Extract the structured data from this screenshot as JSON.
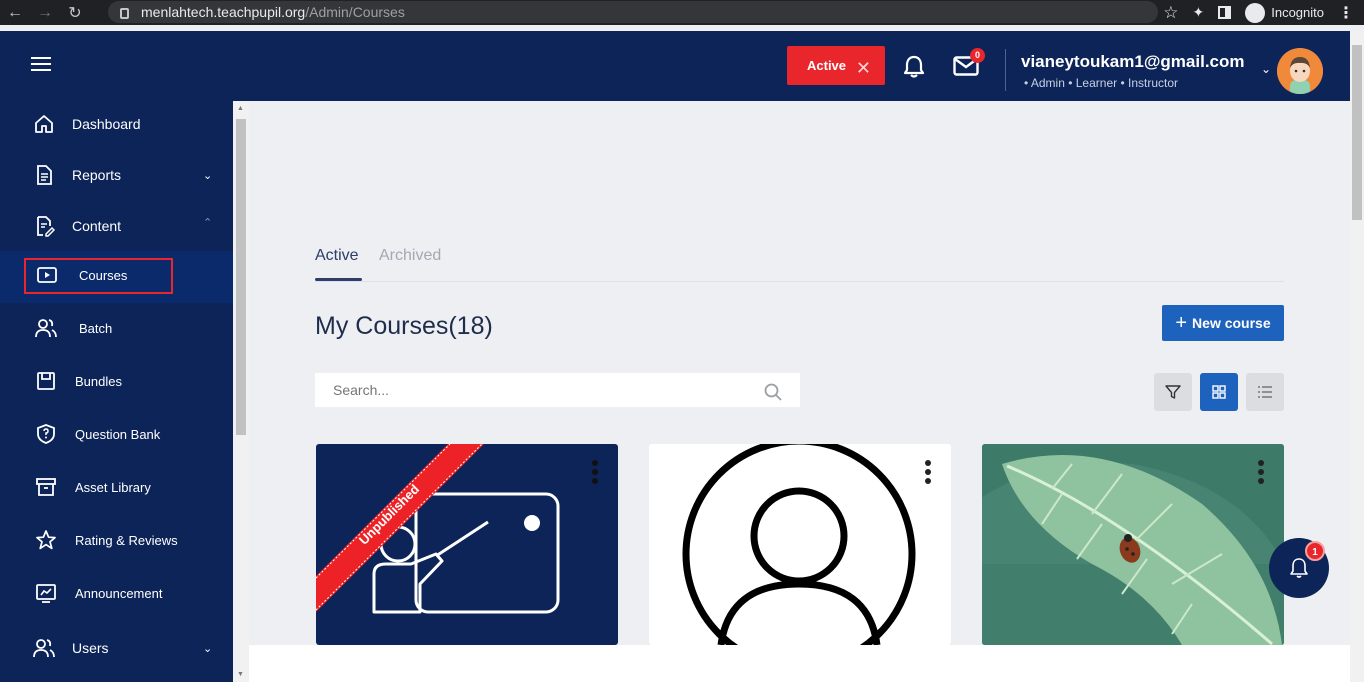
{
  "browser": {
    "url_host": "menlahtech.teachpupil.org",
    "url_path": "/Admin/Courses",
    "incognito_label": "Incognito"
  },
  "header": {
    "status_label": "Active",
    "mail_count": "0",
    "user_email": "vianeytoukam1@gmail.com",
    "user_roles": "• Admin • Learner • Instructor"
  },
  "sidebar": {
    "items": [
      {
        "label": "Dashboard",
        "icon": "home-icon"
      },
      {
        "label": "Reports",
        "icon": "report-icon"
      },
      {
        "label": "Content",
        "icon": "content-icon"
      },
      {
        "label": "Courses",
        "icon": "video-icon"
      },
      {
        "label": "Batch",
        "icon": "users-icon"
      },
      {
        "label": "Bundles",
        "icon": "bundle-icon"
      },
      {
        "label": "Question Bank",
        "icon": "shield-question-icon"
      },
      {
        "label": "Asset Library",
        "icon": "archive-icon"
      },
      {
        "label": "Rating & Reviews",
        "icon": "star-icon"
      },
      {
        "label": "Announcement",
        "icon": "announcement-icon"
      },
      {
        "label": "Users",
        "icon": "users-icon"
      }
    ]
  },
  "main": {
    "tabs": [
      {
        "label": "Active"
      },
      {
        "label": "Archived"
      }
    ],
    "title": "My Courses(18)",
    "new_course_label": "New course",
    "search_placeholder": "Search...",
    "cards": [
      {
        "ribbon": "Unpublished",
        "image": "teacher-board-icon"
      },
      {
        "image": "user-avatar-icon"
      },
      {
        "image": "leaf-ladybug-photo"
      }
    ]
  },
  "notifications": {
    "count": "1"
  },
  "colors": {
    "primary_navy": "#0d2459",
    "accent_red": "#e8262c",
    "button_blue": "#1d63bd"
  }
}
